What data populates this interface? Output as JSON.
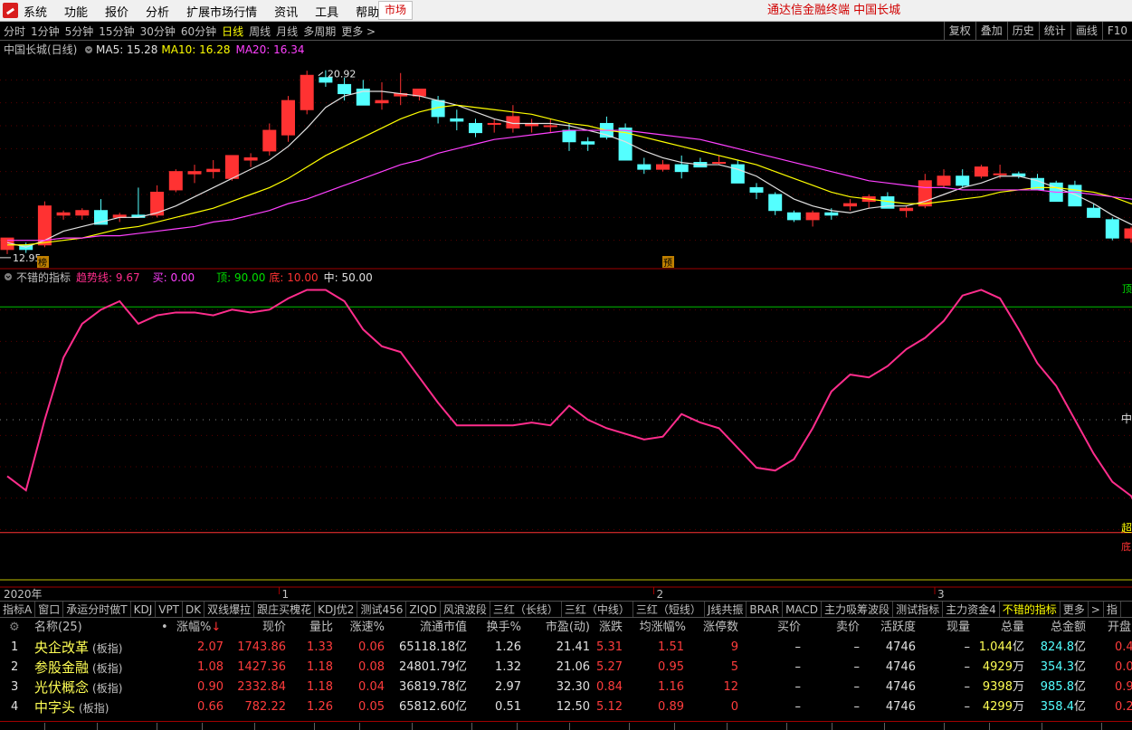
{
  "menubar": {
    "items": [
      "系统",
      "功能",
      "报价",
      "分析",
      "扩展市场行情",
      "资讯",
      "工具",
      "帮助"
    ],
    "market_tab": "市场",
    "app_title": "通达信金融终端  中国长城"
  },
  "toolbar": {
    "periods": [
      "分时",
      "1分钟",
      "5分钟",
      "15分钟",
      "30分钟",
      "60分钟",
      "日线",
      "周线",
      "月线",
      "多周期",
      "更多 >"
    ],
    "active_period": "日线",
    "tools": [
      "复权",
      "叠加",
      "历史",
      "统计",
      "画线",
      "F10"
    ]
  },
  "main_chart": {
    "stock_label": "中国长城(日线)",
    "ma_labels": [
      {
        "text": "MA5: 15.28",
        "color": "#e0e0e0"
      },
      {
        "text": "MA10: 16.28",
        "color": "#ffff00"
      },
      {
        "text": "MA20: 16.34",
        "color": "#ff40ff"
      }
    ],
    "high_label": "20.92",
    "low_label": "12.95",
    "marker_left": "榜",
    "marker_mid": "预"
  },
  "indicator": {
    "title": "不错的指标",
    "trend_label": "趋势线: 9.67",
    "buy_label": "买: 0.00",
    "top_label": "顶: 90.00",
    "bottom_label": "底: 10.00",
    "mid_label": "中: 50.00",
    "right_top": "顶",
    "right_mid": "中",
    "right_over": "超",
    "right_bottom": "底"
  },
  "chart_data": {
    "type": "candlestick",
    "candles": [
      {
        "o": 13.1,
        "h": 13.5,
        "l": 12.9,
        "c": 13.6
      },
      {
        "o": 13.3,
        "h": 13.4,
        "l": 12.95,
        "c": 13.1
      },
      {
        "o": 13.3,
        "h": 15.2,
        "l": 13.2,
        "c": 15.0
      },
      {
        "o": 14.6,
        "h": 14.8,
        "l": 14.4,
        "c": 14.7
      },
      {
        "o": 14.6,
        "h": 14.9,
        "l": 14.4,
        "c": 14.8
      },
      {
        "o": 14.8,
        "h": 15.3,
        "l": 14.2,
        "c": 14.2
      },
      {
        "o": 14.5,
        "h": 14.7,
        "l": 14.3,
        "c": 14.6
      },
      {
        "o": 14.6,
        "h": 15.8,
        "l": 14.5,
        "c": 14.5
      },
      {
        "o": 14.6,
        "h": 15.9,
        "l": 14.5,
        "c": 15.6
      },
      {
        "o": 15.7,
        "h": 16.6,
        "l": 15.6,
        "c": 16.5
      },
      {
        "o": 16.4,
        "h": 16.8,
        "l": 16.0,
        "c": 16.5
      },
      {
        "o": 16.5,
        "h": 17.0,
        "l": 16.2,
        "c": 16.6
      },
      {
        "o": 16.2,
        "h": 17.2,
        "l": 16.1,
        "c": 17.2
      },
      {
        "o": 17.0,
        "h": 17.3,
        "l": 16.7,
        "c": 17.1
      },
      {
        "o": 17.4,
        "h": 18.6,
        "l": 17.2,
        "c": 18.3
      },
      {
        "o": 18.1,
        "h": 19.8,
        "l": 17.8,
        "c": 19.6
      },
      {
        "o": 19.2,
        "h": 20.9,
        "l": 19.0,
        "c": 20.7
      },
      {
        "o": 20.6,
        "h": 20.92,
        "l": 20.2,
        "c": 20.4
      },
      {
        "o": 20.3,
        "h": 20.6,
        "l": 19.6,
        "c": 19.9
      },
      {
        "o": 20.1,
        "h": 20.5,
        "l": 19.4,
        "c": 19.4
      },
      {
        "o": 19.5,
        "h": 20.4,
        "l": 19.2,
        "c": 19.6
      },
      {
        "o": 19.8,
        "h": 20.8,
        "l": 19.4,
        "c": 19.9
      },
      {
        "o": 19.8,
        "h": 20.1,
        "l": 19.6,
        "c": 20.1
      },
      {
        "o": 19.6,
        "h": 19.8,
        "l": 18.6,
        "c": 18.9
      },
      {
        "o": 18.8,
        "h": 19.2,
        "l": 18.3,
        "c": 18.7
      },
      {
        "o": 18.6,
        "h": 18.8,
        "l": 18.0,
        "c": 18.2
      },
      {
        "o": 18.6,
        "h": 18.8,
        "l": 18.2,
        "c": 18.6
      },
      {
        "o": 18.4,
        "h": 19.4,
        "l": 18.2,
        "c": 18.9
      },
      {
        "o": 18.5,
        "h": 18.8,
        "l": 18.2,
        "c": 18.6
      },
      {
        "o": 18.5,
        "h": 18.8,
        "l": 18.2,
        "c": 18.5
      },
      {
        "o": 18.3,
        "h": 18.6,
        "l": 17.4,
        "c": 17.8
      },
      {
        "o": 17.8,
        "h": 18.0,
        "l": 17.4,
        "c": 17.7
      },
      {
        "o": 18.6,
        "h": 18.9,
        "l": 17.9,
        "c": 18.0
      },
      {
        "o": 18.4,
        "h": 18.6,
        "l": 17.0,
        "c": 17.0
      },
      {
        "o": 16.8,
        "h": 17.1,
        "l": 16.4,
        "c": 16.6
      },
      {
        "o": 16.6,
        "h": 17.0,
        "l": 16.5,
        "c": 16.8
      },
      {
        "o": 16.8,
        "h": 17.2,
        "l": 16.2,
        "c": 16.5
      },
      {
        "o": 16.9,
        "h": 17.1,
        "l": 16.8,
        "c": 16.7
      },
      {
        "o": 16.9,
        "h": 17.2,
        "l": 16.8,
        "c": 16.9
      },
      {
        "o": 16.8,
        "h": 17.0,
        "l": 16.0,
        "c": 16.0
      },
      {
        "o": 15.8,
        "h": 16.0,
        "l": 15.3,
        "c": 15.6
      },
      {
        "o": 15.5,
        "h": 15.6,
        "l": 14.6,
        "c": 14.8
      },
      {
        "o": 14.7,
        "h": 14.8,
        "l": 14.3,
        "c": 14.4
      },
      {
        "o": 14.4,
        "h": 14.8,
        "l": 14.1,
        "c": 14.7
      },
      {
        "o": 14.7,
        "h": 14.9,
        "l": 14.4,
        "c": 14.6
      },
      {
        "o": 15.0,
        "h": 15.3,
        "l": 14.8,
        "c": 15.1
      },
      {
        "o": 15.2,
        "h": 15.5,
        "l": 14.9,
        "c": 15.4
      },
      {
        "o": 15.4,
        "h": 15.6,
        "l": 14.9,
        "c": 14.9
      },
      {
        "o": 14.8,
        "h": 15.0,
        "l": 14.5,
        "c": 14.9
      },
      {
        "o": 15.0,
        "h": 16.4,
        "l": 14.9,
        "c": 16.1
      },
      {
        "o": 15.9,
        "h": 16.6,
        "l": 15.8,
        "c": 16.3
      },
      {
        "o": 16.3,
        "h": 16.6,
        "l": 15.8,
        "c": 15.9
      },
      {
        "o": 16.3,
        "h": 16.8,
        "l": 16.2,
        "c": 16.7
      },
      {
        "o": 16.4,
        "h": 16.8,
        "l": 16.2,
        "c": 16.4
      },
      {
        "o": 16.4,
        "h": 16.5,
        "l": 16.2,
        "c": 16.3
      },
      {
        "o": 16.2,
        "h": 16.4,
        "l": 15.7,
        "c": 15.7
      },
      {
        "o": 16.0,
        "h": 16.1,
        "l": 15.2,
        "c": 15.2
      },
      {
        "o": 15.9,
        "h": 16.1,
        "l": 15.0,
        "c": 15.0
      },
      {
        "o": 14.9,
        "h": 15.1,
        "l": 14.5,
        "c": 14.5
      },
      {
        "o": 14.4,
        "h": 14.5,
        "l": 13.5,
        "c": 13.6
      },
      {
        "o": 13.6,
        "h": 14.1,
        "l": 13.4,
        "c": 14.0
      },
      {
        "o": 13.9,
        "h": 14.2,
        "l": 13.6,
        "c": 13.6
      }
    ],
    "ma5": [
      13.4,
      13.2,
      13.5,
      13.9,
      14.1,
      14.3,
      14.5,
      14.5,
      14.7,
      15.0,
      15.4,
      15.8,
      16.2,
      16.6,
      17.0,
      17.6,
      18.4,
      19.3,
      19.8,
      20.0,
      20.0,
      19.9,
      19.8,
      19.6,
      19.4,
      19.1,
      18.8,
      18.6,
      18.6,
      18.6,
      18.5,
      18.3,
      18.1,
      17.8,
      17.4,
      17.1,
      16.9,
      16.8,
      16.8,
      16.6,
      16.3,
      15.8,
      15.3,
      15.0,
      14.8,
      14.7,
      14.9,
      15.0,
      15.0,
      15.2,
      15.5,
      15.8,
      16.0,
      16.3,
      16.3,
      16.1,
      15.8,
      15.5,
      15.1,
      14.6,
      14.2,
      13.8
    ],
    "ma10": [
      13.3,
      13.3,
      13.4,
      13.5,
      13.6,
      13.8,
      14.0,
      14.1,
      14.3,
      14.5,
      14.7,
      14.9,
      15.2,
      15.5,
      15.8,
      16.2,
      16.7,
      17.2,
      17.6,
      18.0,
      18.4,
      18.8,
      19.1,
      19.3,
      19.4,
      19.3,
      19.2,
      19.1,
      19.0,
      18.8,
      18.6,
      18.5,
      18.3,
      18.2,
      18.0,
      17.8,
      17.6,
      17.4,
      17.2,
      17.0,
      16.8,
      16.5,
      16.2,
      15.9,
      15.6,
      15.4,
      15.3,
      15.2,
      15.1,
      15.1,
      15.2,
      15.3,
      15.4,
      15.6,
      15.7,
      15.8,
      15.8,
      15.7,
      15.6,
      15.4,
      15.1,
      14.9
    ],
    "ma20": [
      13.5,
      13.5,
      13.5,
      13.6,
      13.6,
      13.7,
      13.7,
      13.8,
      13.9,
      14.0,
      14.1,
      14.3,
      14.4,
      14.6,
      14.8,
      15.1,
      15.3,
      15.6,
      15.9,
      16.2,
      16.5,
      16.8,
      17.0,
      17.3,
      17.5,
      17.7,
      17.9,
      18.0,
      18.1,
      18.2,
      18.3,
      18.3,
      18.3,
      18.3,
      18.2,
      18.1,
      18.0,
      17.9,
      17.7,
      17.5,
      17.3,
      17.1,
      16.9,
      16.7,
      16.5,
      16.3,
      16.1,
      16.0,
      15.9,
      15.8,
      15.8,
      15.7,
      15.7,
      15.7,
      15.7,
      15.7,
      15.6,
      15.6,
      15.5,
      15.4,
      15.3,
      15.2
    ],
    "trend": [
      30,
      25,
      50,
      72,
      84,
      89,
      92,
      84,
      87,
      88,
      88,
      87,
      89,
      88,
      89,
      93,
      96,
      96,
      92,
      82,
      76,
      74,
      65,
      56,
      48,
      48,
      48,
      48,
      49,
      48,
      55,
      50,
      47,
      45,
      43,
      44,
      52,
      49,
      47,
      40,
      33,
      32,
      36,
      47,
      60,
      66,
      65,
      69,
      75,
      79,
      85,
      94,
      96,
      93,
      82,
      70,
      62,
      50,
      38,
      28,
      23,
      9.67
    ],
    "ylim": [
      12.5,
      21.5
    ],
    "indicator_levels": {
      "top": 90,
      "mid": 50,
      "bottom": 10
    }
  },
  "axis": {
    "year_label": "2020年",
    "month_labels": [
      {
        "text": "1",
        "index": 15
      },
      {
        "text": "2",
        "index": 35
      },
      {
        "text": "3",
        "index": 50
      }
    ]
  },
  "indicator_tabs": {
    "items": [
      "指标A",
      "窗口",
      "承运分时做T",
      "KDJ",
      "VPT",
      "DK",
      "双线爆拉",
      "跟庄买槐花",
      "KDJ优2",
      "测试456",
      "ZIQD",
      "风浪波段",
      "三红（长线）",
      "三红（中线）",
      "三红（短线）",
      "J线共振",
      "BRAR",
      "MACD",
      "主力吸筹波段",
      "测试指标",
      "主力资金4",
      "不错的指标",
      "更多",
      ">",
      "指"
    ],
    "active": "不错的指标"
  },
  "table": {
    "headers": {
      "name": "名称(25)",
      "dot": "•",
      "change_pct": "涨幅%",
      "price": "现价",
      "vol_ratio": "量比",
      "speed": "涨速%",
      "float_mv": "流通市值",
      "turnover": "换手%",
      "pe": "市盈(动)",
      "change": "涨跌",
      "avg_change": "均涨幅%",
      "limit_up": "涨停数",
      "bid": "买价",
      "ask": "卖价",
      "activity": "活跃度",
      "cur_vol": "现量",
      "total_vol": "总量",
      "amount": "总金额",
      "open": "开盘"
    },
    "rows": [
      {
        "no": "1",
        "name": "央企改革",
        "tag": "(板指)",
        "change_pct": "2.07",
        "price": "1743.86",
        "vol_ratio": "1.33",
        "speed": "0.06",
        "float_mv": "65118.18",
        "float_unit": "亿",
        "turnover": "1.26",
        "pe": "21.41",
        "change": "5.31",
        "avg_change": "1.51",
        "limit_up": "9",
        "bid": "–",
        "ask": "–",
        "activity": "4746",
        "cur_vol": "–",
        "total_vol": "1.044",
        "total_unit": "亿",
        "amount": "824.8",
        "amount_unit": "亿",
        "open": "0.4"
      },
      {
        "no": "2",
        "name": "参股金融",
        "tag": "(板指)",
        "change_pct": "1.08",
        "price": "1427.36",
        "vol_ratio": "1.18",
        "speed": "0.08",
        "float_mv": "24801.79",
        "float_unit": "亿",
        "turnover": "1.32",
        "pe": "21.06",
        "change": "5.27",
        "avg_change": "0.95",
        "limit_up": "5",
        "bid": "–",
        "ask": "–",
        "activity": "4746",
        "cur_vol": "–",
        "total_vol": "4929",
        "total_unit": "万",
        "amount": "354.3",
        "amount_unit": "亿",
        "open": "0.0"
      },
      {
        "no": "3",
        "name": "光伏概念",
        "tag": "(板指)",
        "change_pct": "0.90",
        "price": "2332.84",
        "vol_ratio": "1.18",
        "speed": "0.04",
        "float_mv": "36819.78",
        "float_unit": "亿",
        "turnover": "2.97",
        "pe": "32.30",
        "change": "0.84",
        "avg_change": "1.16",
        "limit_up": "12",
        "bid": "–",
        "ask": "–",
        "activity": "4746",
        "cur_vol": "–",
        "total_vol": "9398",
        "total_unit": "万",
        "amount": "985.8",
        "amount_unit": "亿",
        "open": "0.9"
      },
      {
        "no": "4",
        "name": "中字头",
        "tag": "(板指)",
        "change_pct": "0.66",
        "price": "782.22",
        "vol_ratio": "1.26",
        "speed": "0.05",
        "float_mv": "65812.60",
        "float_unit": "亿",
        "turnover": "0.51",
        "pe": "12.50",
        "change": "5.12",
        "avg_change": "0.89",
        "limit_up": "0",
        "bid": "–",
        "ask": "–",
        "activity": "4746",
        "cur_vol": "–",
        "total_vol": "4299",
        "total_unit": "万",
        "amount": "358.4",
        "amount_unit": "亿",
        "open": "0.2"
      }
    ]
  },
  "colors": {
    "up": "#ff3232",
    "down": "#54ffff",
    "ma5": "#e0e0e0",
    "ma10": "#ffff00",
    "ma20": "#ff40ff",
    "trend": "#ff2d8c"
  }
}
